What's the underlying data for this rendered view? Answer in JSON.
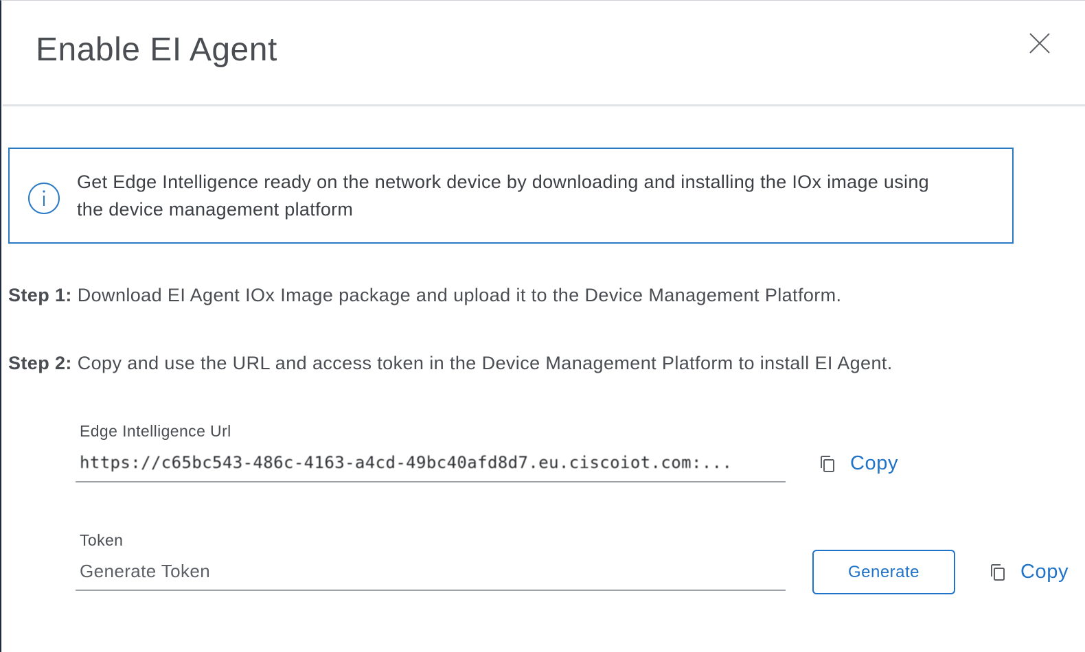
{
  "dialog": {
    "title": "Enable EI Agent",
    "close_icon": "close-icon"
  },
  "info_banner": {
    "icon": "info-icon",
    "text": "Get Edge Intelligence ready on the network device by downloading and installing the IOx image using the device management platform"
  },
  "steps": [
    {
      "label": "Step 1:",
      "text": "Download EI Agent IOx Image package and upload it to the Device Management Platform."
    },
    {
      "label": "Step 2:",
      "text": "Copy and use the URL and access token in the Device Management Platform to install EI Agent."
    }
  ],
  "url_field": {
    "label": "Edge Intelligence Url",
    "value": "https://c65bc543-486c-4163-a4cd-49bc40afd8d7.eu.ciscoiot.com:...",
    "copy_label": "Copy",
    "copy_icon": "copy-icon"
  },
  "token_field": {
    "label": "Token",
    "placeholder": "Generate Token",
    "generate_label": "Generate",
    "copy_label": "Copy",
    "copy_icon": "copy-icon"
  },
  "colors": {
    "accent": "#1f73c8",
    "banner_border": "#2a79c4",
    "text": "#4a4d52"
  }
}
